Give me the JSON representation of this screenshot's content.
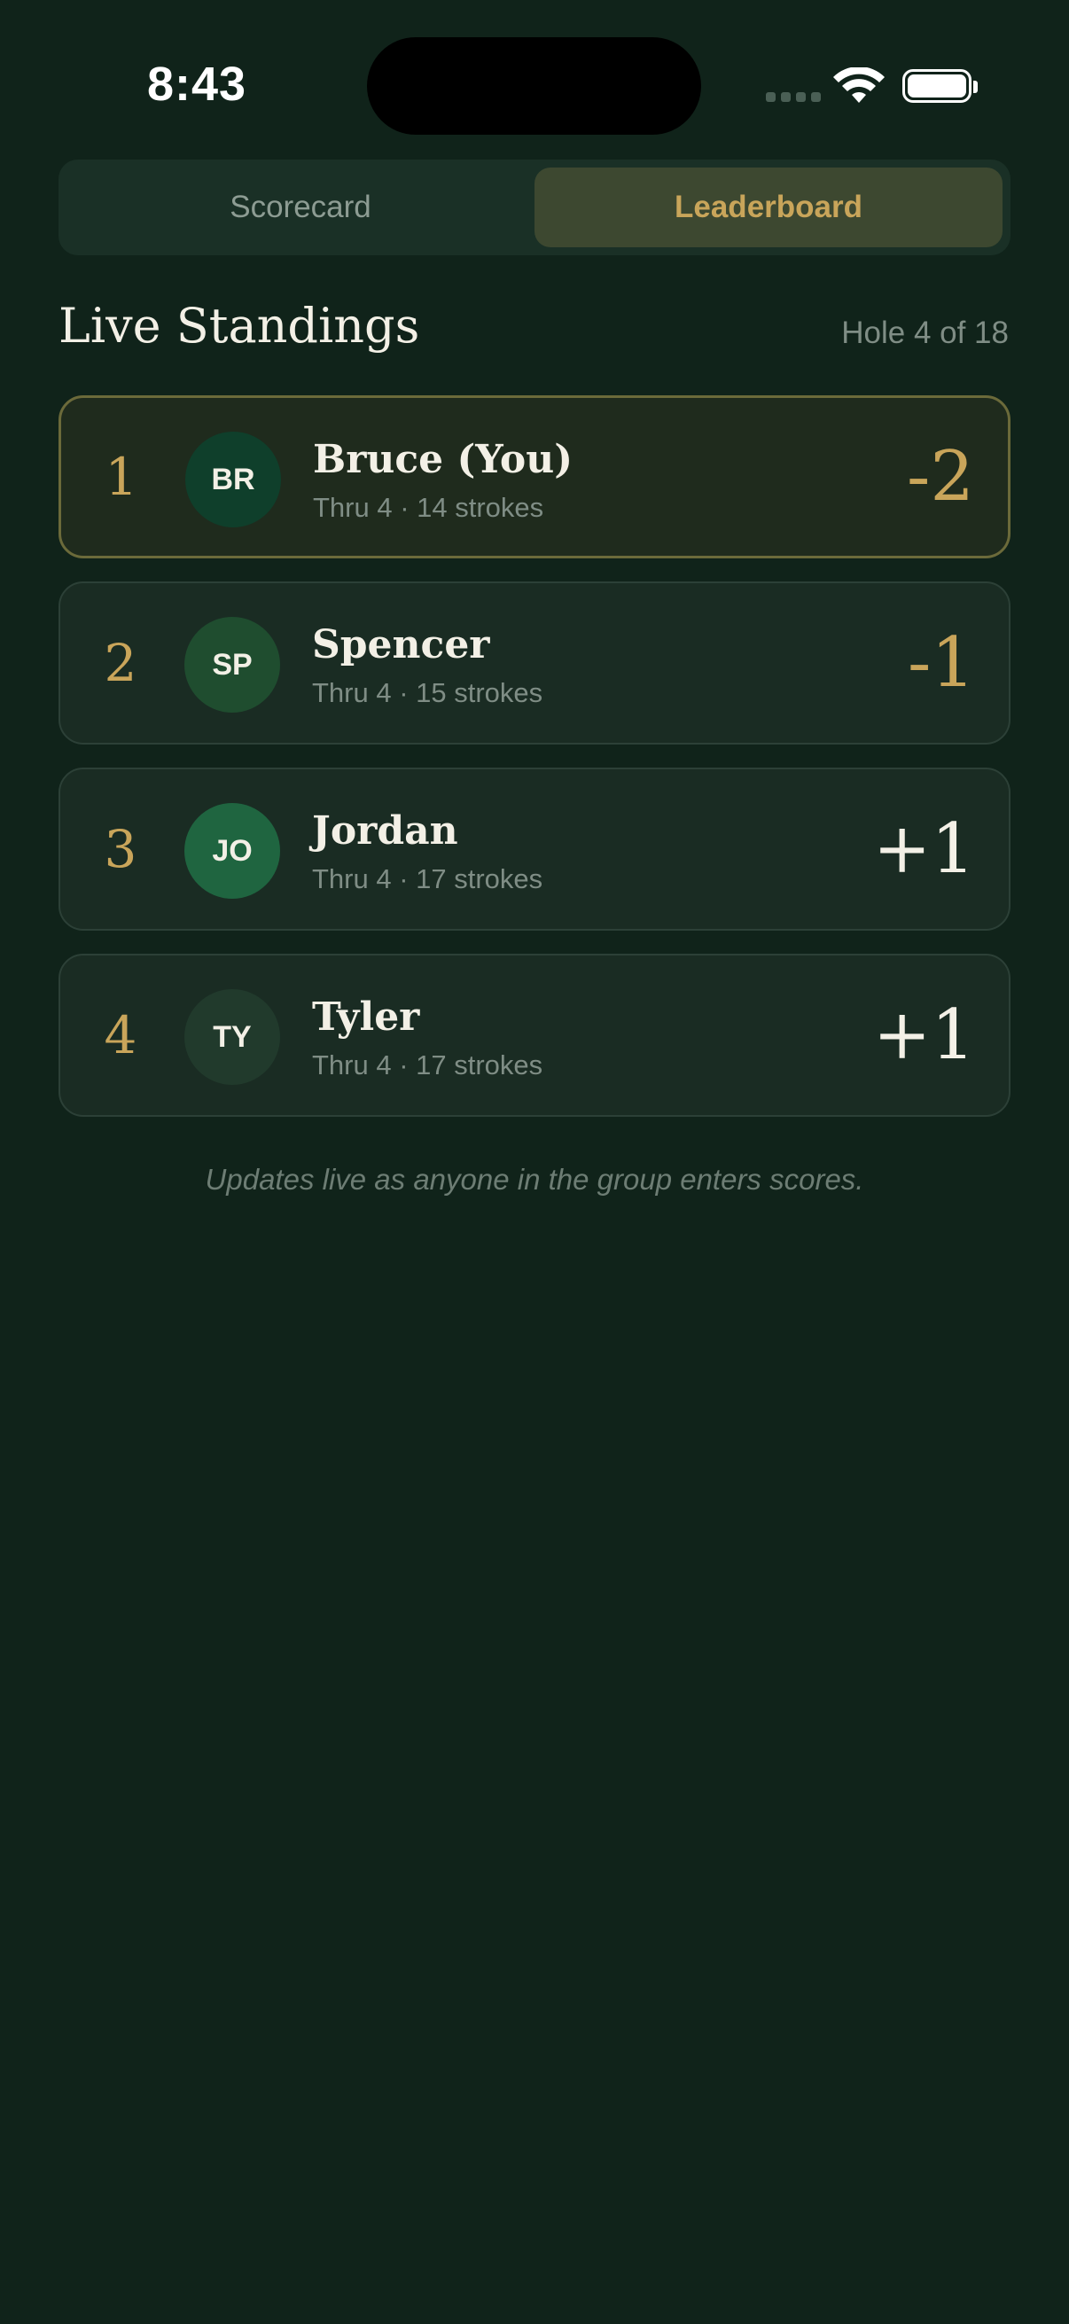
{
  "status_bar": {
    "time": "8:43",
    "icons": [
      "signal-icon",
      "wifi-icon",
      "battery-icon"
    ]
  },
  "tabs": [
    {
      "label": "Scorecard",
      "selected": false
    },
    {
      "label": "Leaderboard",
      "selected": true
    }
  ],
  "header": {
    "title": "Live Standings",
    "hole_progress": "Hole 4 of 18"
  },
  "players": [
    {
      "rank": "1",
      "initials": "BR",
      "name": "Bruce (You)",
      "detail": "Thru 4 · 14 strokes",
      "score": "-2",
      "avatar_color": "#0f3f2b",
      "is_you": true
    },
    {
      "rank": "2",
      "initials": "SP",
      "name": "Spencer",
      "detail": "Thru 4 · 15 strokes",
      "score": "-1",
      "avatar_color": "#1f4d2f",
      "is_you": false
    },
    {
      "rank": "3",
      "initials": "JO",
      "name": "Jordan",
      "detail": "Thru 4 · 17 strokes",
      "score": "+1",
      "avatar_color": "#1f6540",
      "is_you": false
    },
    {
      "rank": "4",
      "initials": "TY",
      "name": "Tyler",
      "detail": "Thru 4 · 17 strokes",
      "score": "+1",
      "avatar_color": "#213a2c",
      "is_you": false
    }
  ],
  "footer_note": "Updates live as anyone in the group enters scores.",
  "colors": {
    "background": "#10231a",
    "accent_gold": "#c9a55a",
    "card": "#1a2c23",
    "highlight_card": "#1f2b1d"
  }
}
